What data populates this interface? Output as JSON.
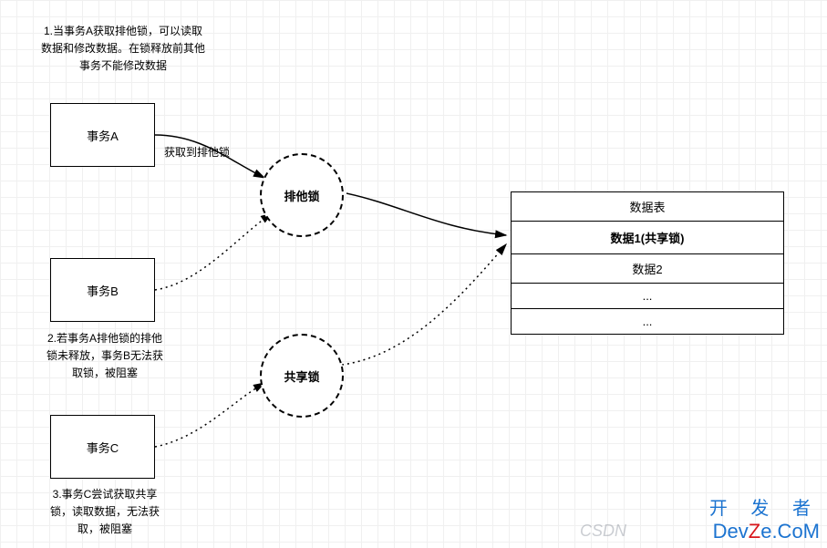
{
  "boxes": {
    "a": "事务A",
    "b": "事务B",
    "c": "事务C"
  },
  "captions": {
    "a": "1.当事务A获取排他锁，可以读取数据和修改数据。在锁释放前其他事务不能修改数据",
    "b": "2.若事务A排他锁的排他锁未释放，事务B无法获取锁，被阻塞",
    "c": "3.事务C尝试获取共享锁，读取数据，无法获取，被阻塞"
  },
  "locks": {
    "exclusive": "排他锁",
    "shared": "共享锁"
  },
  "edge_labels": {
    "a_to_exclusive": "获取到排他锁"
  },
  "table": {
    "header": "数据表",
    "rows": [
      "数据1(共享锁)",
      "数据2",
      "...",
      "..."
    ]
  },
  "watermarks": {
    "csdn": "CSDN",
    "dev_top": "开 发 者",
    "dev_bottom_pre": "Dev",
    "dev_bottom_z": "Z",
    "dev_bottom_post": "e.CoM"
  }
}
